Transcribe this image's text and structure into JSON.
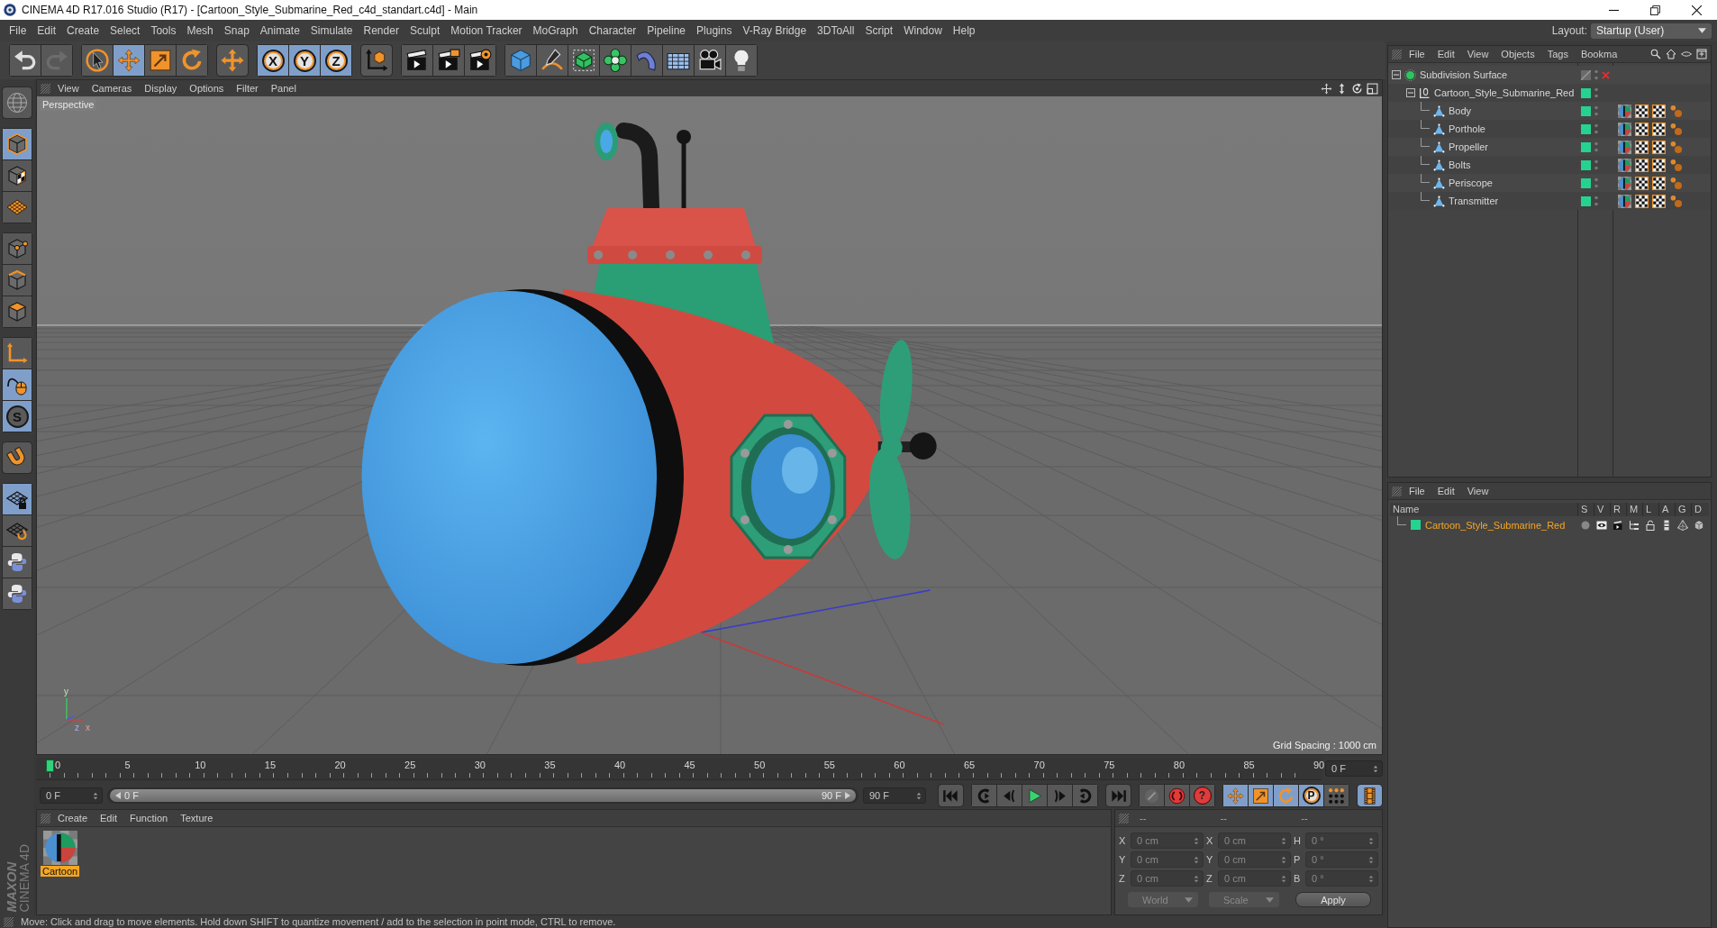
{
  "window": {
    "title": "CINEMA 4D R17.016 Studio (R17) - [Cartoon_Style_Submarine_Red_c4d_standart.c4d] - Main"
  },
  "menu_bar": {
    "items": [
      "File",
      "Edit",
      "Create",
      "Select",
      "Tools",
      "Mesh",
      "Snap",
      "Animate",
      "Simulate",
      "Render",
      "Sculpt",
      "Motion Tracker",
      "MoGraph",
      "Character",
      "Pipeline",
      "Plugins",
      "V-Ray Bridge",
      "3DToAll",
      "Script",
      "Window",
      "Help"
    ],
    "layout_label": "Layout:",
    "layout_value": "Startup (User)"
  },
  "toolbar": {
    "groups": [
      [
        {
          "selected": false,
          "disabled": false
        },
        {
          "selected": false,
          "disabled": true
        }
      ],
      [
        {
          "selected": false,
          "disabled": false
        },
        {
          "selected": true,
          "disabled": false
        },
        {
          "selected": false,
          "disabled": false
        },
        {
          "selected": false,
          "disabled": false
        }
      ],
      [
        {
          "selected": false,
          "disabled": false
        }
      ],
      [
        {
          "label": "X",
          "selected": true,
          "disabled": false
        },
        {
          "label": "Y",
          "selected": true,
          "disabled": false
        },
        {
          "label": "Z",
          "selected": true,
          "disabled": false
        }
      ],
      [
        {
          "selected": false,
          "disabled": false
        }
      ],
      [
        {
          "selected": false,
          "disabled": false
        },
        {
          "selected": false,
          "disabled": false
        },
        {
          "selected": false,
          "disabled": false
        }
      ],
      [
        {
          "selected": false,
          "disabled": false
        },
        {
          "selected": false,
          "disabled": false
        },
        {
          "selected": false,
          "disabled": false
        },
        {
          "selected": false,
          "disabled": false
        },
        {
          "selected": false,
          "disabled": false
        },
        {
          "selected": false,
          "disabled": false
        },
        {
          "selected": false,
          "disabled": false
        },
        {
          "selected": false,
          "disabled": false
        }
      ]
    ]
  },
  "left_toolbar": {
    "groups": [
      [
        {
          "selected": false
        }
      ],
      [
        {
          "selected": true
        },
        {
          "selected": false
        },
        {
          "selected": false
        }
      ],
      [
        {
          "selected": false
        },
        {
          "selected": false
        },
        {
          "selected": false
        }
      ],
      [
        {
          "selected": false
        },
        {
          "selected": true
        },
        {
          "label": "S",
          "selected": true
        }
      ],
      [
        {
          "selected": false
        }
      ],
      [
        {
          "selected": true
        },
        {
          "selected": false
        },
        {
          "selected": false
        },
        {
          "selected": false
        }
      ]
    ]
  },
  "viewport": {
    "menu": [
      "View",
      "Cameras",
      "Display",
      "Options",
      "Filter",
      "Panel"
    ],
    "camera": "Perspective",
    "axis_labels": [
      "y",
      "z",
      "x"
    ],
    "grid_spacing": "Grid Spacing : 1000 cm"
  },
  "timeline": {
    "ticks": [
      "0",
      "5",
      "10",
      "15",
      "20",
      "25",
      "30",
      "35",
      "40",
      "45",
      "50",
      "55",
      "60",
      "65",
      "70",
      "75",
      "80",
      "85",
      "90"
    ],
    "playhead": {
      "level": 0
    },
    "frame_field": "0 F"
  },
  "transport": {
    "start_field": "0 F",
    "range": {
      "start": "0 F",
      "end": "90 F",
      "level": 1
    },
    "end_field": "90 F",
    "groups": [
      [
        {
          "selected": false,
          "disabled": false
        }
      ],
      [
        {
          "selected": false,
          "disabled": false
        },
        {
          "selected": false,
          "disabled": false
        },
        {
          "selected": false,
          "disabled": false
        },
        {
          "selected": false,
          "disabled": false
        },
        {
          "selected": false,
          "disabled": false
        }
      ],
      [
        {
          "selected": false,
          "disabled": false
        }
      ],
      [
        {
          "selected": false,
          "disabled": true
        },
        {
          "selected": false,
          "disabled": false
        },
        {
          "label": "?",
          "selected": false,
          "disabled": false
        }
      ],
      [
        {
          "selected": true,
          "disabled": false
        },
        {
          "selected": true,
          "disabled": false
        },
        {
          "selected": true,
          "disabled": false
        },
        {
          "label": "P",
          "selected": true,
          "disabled": false
        },
        {
          "selected": false,
          "disabled": false
        }
      ],
      [
        {
          "selected": true,
          "disabled": false
        }
      ]
    ]
  },
  "material_manager": {
    "menu": [
      "Create",
      "Edit",
      "Function",
      "Texture"
    ],
    "materials": [
      {
        "name": "Cartoon",
        "selected": true
      }
    ]
  },
  "coordinates": {
    "headers": [
      "--",
      "--",
      "--"
    ],
    "rows": [
      {
        "position_label": "X",
        "position": "0 cm",
        "size_label": "X",
        "size": "0 cm",
        "rotation_label": "H",
        "rotation": "0 °"
      },
      {
        "position_label": "Y",
        "position": "0 cm",
        "size_label": "Y",
        "size": "0 cm",
        "rotation_label": "P",
        "rotation": "0 °"
      },
      {
        "position_label": "Z",
        "position": "0 cm",
        "size_label": "Z",
        "size": "0 cm",
        "rotation_label": "B",
        "rotation": "0 °"
      }
    ],
    "coordinate_system": "World",
    "size_mode": "Scale",
    "apply": "Apply"
  },
  "branding": {
    "company": "MAXON",
    "product": "CINEMA 4D"
  },
  "status_bar": {
    "text": "Move: Click and drag to move elements. Hold down SHIFT to quantize movement / add to the selection in point mode, CTRL to remove."
  },
  "object_manager": {
    "menu": [
      "File",
      "Edit",
      "View",
      "Objects",
      "Tags",
      "Bookma"
    ],
    "objects": [
      {
        "name": "Subdivision Surface",
        "kind": "subdivision",
        "selected": false,
        "expanded": true,
        "enabled": false,
        "children": [
          {
            "name": "Cartoon_Style_Submarine_Red",
            "kind": "null",
            "selected": false,
            "expanded": true,
            "color": "#25d391",
            "children": [
              {
                "name": "Body",
                "kind": "polygon",
                "selected": false,
                "color": "#25d391",
                "tags": [
                  {
                    "kind": "material"
                  },
                  {
                    "kind": "uvw"
                  },
                  {
                    "kind": "uvw"
                  },
                  {
                    "kind": "phong"
                  }
                ]
              },
              {
                "name": "Porthole",
                "kind": "polygon",
                "selected": false,
                "color": "#25d391",
                "tags": [
                  {
                    "kind": "material"
                  },
                  {
                    "kind": "uvw"
                  },
                  {
                    "kind": "uvw"
                  },
                  {
                    "kind": "phong"
                  }
                ]
              },
              {
                "name": "Propeller",
                "kind": "polygon",
                "selected": false,
                "color": "#25d391",
                "tags": [
                  {
                    "kind": "material"
                  },
                  {
                    "kind": "uvw"
                  },
                  {
                    "kind": "uvw"
                  },
                  {
                    "kind": "phong"
                  }
                ]
              },
              {
                "name": "Bolts",
                "kind": "polygon",
                "selected": false,
                "color": "#25d391",
                "tags": [
                  {
                    "kind": "material"
                  },
                  {
                    "kind": "uvw"
                  },
                  {
                    "kind": "uvw"
                  },
                  {
                    "kind": "phong"
                  }
                ]
              },
              {
                "name": "Periscope",
                "kind": "polygon",
                "selected": false,
                "color": "#25d391",
                "tags": [
                  {
                    "kind": "material"
                  },
                  {
                    "kind": "uvw"
                  },
                  {
                    "kind": "uvw"
                  },
                  {
                    "kind": "phong"
                  }
                ]
              },
              {
                "name": "Transmitter",
                "kind": "polygon",
                "selected": false,
                "color": "#25d391",
                "tags": [
                  {
                    "kind": "material"
                  },
                  {
                    "kind": "uvw"
                  },
                  {
                    "kind": "uvw"
                  },
                  {
                    "kind": "phong"
                  }
                ]
              }
            ]
          }
        ]
      }
    ]
  },
  "layer_manager": {
    "menu": [
      "File",
      "Edit",
      "View"
    ],
    "columns": [
      "Name",
      "S",
      "V",
      "R",
      "M",
      "L",
      "A",
      "G",
      "D"
    ],
    "layers": [
      {
        "name": "Cartoon_Style_Submarine_Red",
        "color": "#25d391",
        "selected": true
      }
    ]
  }
}
